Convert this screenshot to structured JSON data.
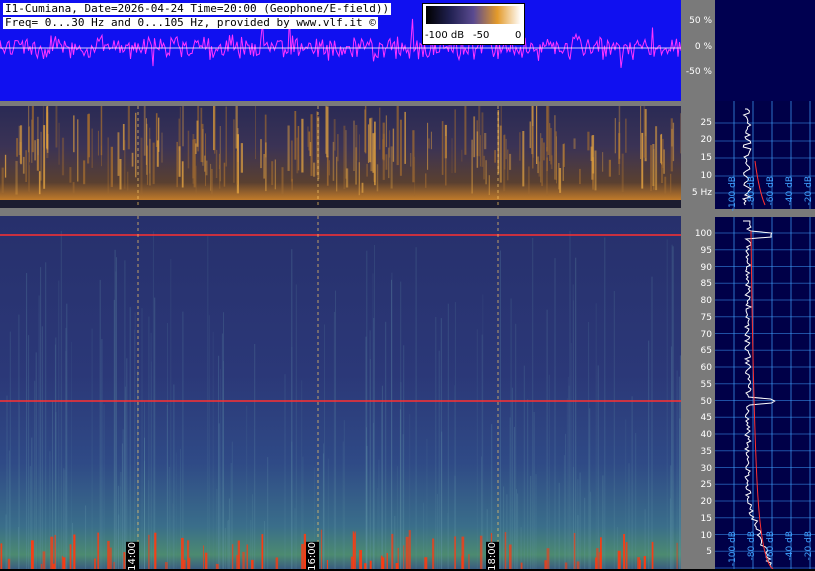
{
  "header": {
    "line1": "I1-Cumiana, Date=2026-04-24 Time=20:00 (Geophone/E-field))",
    "line2": "Freq= 0...30 Hz and 0...105 Hz, provided by www.vlf.it ©"
  },
  "colorbar": {
    "labels": [
      "-100 dB",
      "-50",
      "0"
    ]
  },
  "waveform_axis": {
    "labels": [
      "50 %",
      "0 %",
      "-50 %"
    ]
  },
  "low_axis": {
    "labels": [
      "25",
      "20",
      "15",
      "10",
      "5 Hz"
    ]
  },
  "high_axis": {
    "labels": [
      "100",
      "95",
      "90",
      "85",
      "80",
      "75",
      "70",
      "65",
      "60",
      "55",
      "50",
      "45",
      "40",
      "35",
      "30",
      "25",
      "20",
      "15",
      "10",
      "5"
    ]
  },
  "time_axis": {
    "labels": [
      "14:00",
      "16:00",
      "18:00"
    ]
  },
  "profile_low": {
    "labels": [
      "-100 dB",
      "-80 dB",
      "-60 dB",
      "-40 dB",
      "-20 dB"
    ]
  },
  "profile_high": {
    "labels": [
      "-100 dB",
      "-80 dB",
      "-60 dB",
      "-40 dB",
      "-20 dB"
    ]
  },
  "colors": {
    "waveform_bg": "#1010f0",
    "waveform_trace": "#ff33ff",
    "hum_line": "#ff3030",
    "profile_grid": "#3fa0ff"
  }
}
